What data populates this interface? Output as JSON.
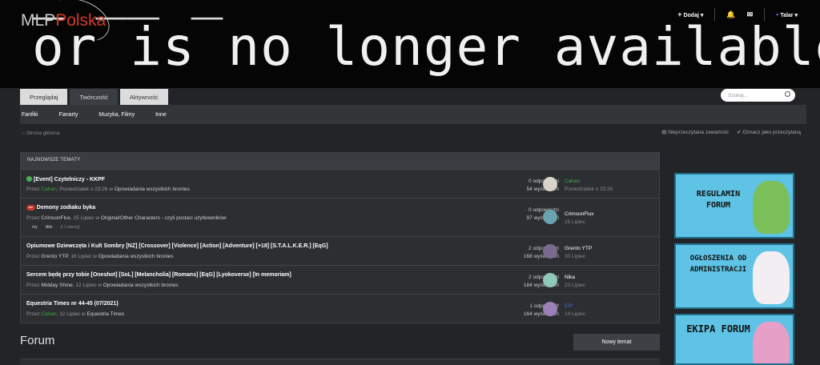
{
  "logo": {
    "mlp": "MLP",
    "pol": "Polska"
  },
  "banner": {
    "line_top": "     _  __  _ ",
    "line_main": "or is no longer available."
  },
  "topnav": {
    "add": "Dodaj",
    "user": "Talar"
  },
  "tabs": [
    {
      "label": "Przeglądaj"
    },
    {
      "label": "Twórczość"
    },
    {
      "label": "Aktywność"
    }
  ],
  "search": {
    "placeholder": "Szukaj..."
  },
  "subnav": [
    "Fanfiki",
    "Fanarty",
    "Muzyka, Filmy",
    "Inne"
  ],
  "breadcrumb": "Strona główna",
  "links": {
    "unread": "Nieprzeczytana zawartość",
    "mark_read": "Oznacz jako przeczytaną"
  },
  "topics": {
    "header": "NAJNOWSZE TEMATY",
    "rows": [
      {
        "title": "[Event] Czytelniczy - KKPF",
        "prefix": "Przez ",
        "author": "Cahan",
        "date": ", Poniedziałek o 23:26 w ",
        "forum": "Opowiadania wszystkich bronies",
        "replies": "0 odpowiedzi",
        "views": "54 wyświetleń",
        "last_user": "Cahan",
        "last_date": "Poniedziałek o 23:26"
      },
      {
        "title": "Demony zodiaku byka",
        "badge": "oc",
        "prefix": "Przez ",
        "author": "CrimsonFlux",
        "date": ", 25 Lipiec w ",
        "forum": "Original/Other Characters - czyli postaci użytkowników",
        "tags": [
          "my",
          "little",
          "(i 1 więcej)"
        ],
        "replies": "0 odpowiedzi",
        "views": "97 wyświetleń",
        "last_user": "CrimsonFlux",
        "last_date": "25 Lipiec"
      },
      {
        "title": "Opiumowe Dziewczęta i Kult Sombry [NZ] [Crossover] [Violence] [Action] [Adventure] [+18] [S.T.A.L.K.E.R.] [EqG]",
        "prefix": "Przez ",
        "author": "Grento YTP",
        "date": ", 16 Lipiec w ",
        "forum": "Opowiadania wszystkich bronies",
        "replies": "2 odpowiedzi",
        "views": "168 wyświetleń",
        "last_user": "Grento YTP",
        "last_date": "30 Lipiec"
      },
      {
        "title": "Sercem będę przy tobie [Oneshot] [SoL] [Melancholia] [Romans] [EqG] [Lyokoverse] [In memoriam]",
        "prefix": "Przez ",
        "author": "Midday Shine",
        "date": ", 12 Lipiec w ",
        "forum": "Opowiadania wszystkich bronies",
        "replies": "2 odpowiedzi",
        "views": "184 wyświetleń",
        "last_user": "Nika",
        "last_date": "23 Lipiec"
      },
      {
        "title": "Equestria Times nr 44-45 (07/2021)",
        "prefix": "Przez ",
        "author": "Cahan",
        "date": ", 12 Lipiec w ",
        "forum": "Equestria Times",
        "replies": "1 odpowiedź",
        "views": "164 wyświetleń",
        "last_user": "EIP",
        "last_date": "14 Lipiec"
      }
    ]
  },
  "forum": {
    "heading": "Forum",
    "new_topic": "Nowy temat"
  },
  "sidebar": [
    {
      "text": "REGULAMIN FORUM"
    },
    {
      "text": "OGŁOSZENIA OD ADMINISTRACJI"
    },
    {
      "text": "EKIPA FORUM"
    }
  ],
  "colors": {
    "bg": "#232427",
    "panel": "#2c2e32",
    "accent_green": "#3fa83f",
    "accent_blue": "#3e6fd0",
    "banner_blue": "#5ec3e4"
  }
}
